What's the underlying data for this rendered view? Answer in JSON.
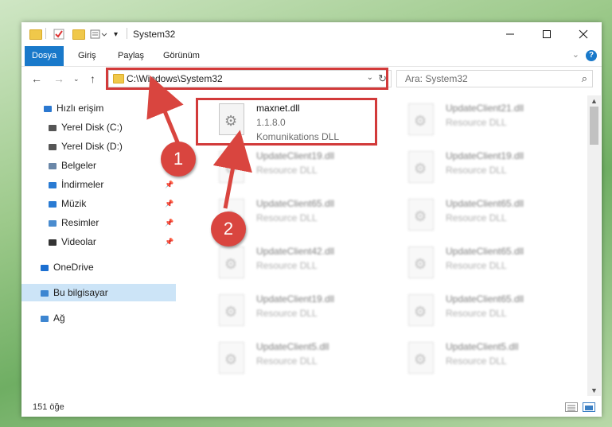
{
  "window": {
    "title": "System32"
  },
  "ribbon": {
    "tabs": [
      "Dosya",
      "Giriş",
      "Paylaş",
      "Görünüm"
    ]
  },
  "address": {
    "path": "C:\\Windows\\System32"
  },
  "search": {
    "placeholder": "Ara: System32"
  },
  "sidebar": {
    "items": [
      {
        "label": "Hızlı erişim",
        "icon": "star-icon"
      },
      {
        "label": "Yerel Disk (C:)",
        "icon": "drive-icon"
      },
      {
        "label": "Yerel Disk (D:)",
        "icon": "drive-icon"
      },
      {
        "label": "Belgeler",
        "icon": "documents-icon"
      },
      {
        "label": "İndirmeler",
        "icon": "download-icon"
      },
      {
        "label": "Müzik",
        "icon": "music-icon"
      },
      {
        "label": "Resimler",
        "icon": "pictures-icon"
      },
      {
        "label": "Videolar",
        "icon": "video-icon"
      },
      {
        "label": "OneDrive",
        "icon": "cloud-icon"
      },
      {
        "label": "Bu bilgisayar",
        "icon": "computer-icon"
      },
      {
        "label": "Ağ",
        "icon": "network-icon"
      }
    ]
  },
  "files": [
    {
      "name": "maxnet.dll",
      "version": "1.1.8.0",
      "desc": "Komunikations DLL"
    },
    {
      "name": "UpdateClient21.dll",
      "desc": "Resource DLL"
    },
    {
      "name": "UpdateClient19.dll",
      "desc": "Resource DLL"
    },
    {
      "name": "UpdateClient19.dll",
      "desc": "Resource DLL"
    },
    {
      "name": "UpdateClient65.dll",
      "desc": "Resource DLL"
    },
    {
      "name": "UpdateClient65.dll",
      "desc": "Resource DLL"
    },
    {
      "name": "UpdateClient42.dll",
      "desc": "Resource DLL"
    },
    {
      "name": "UpdateClient65.dll",
      "desc": "Resource DLL"
    },
    {
      "name": "UpdateClient19.dll",
      "desc": "Resource DLL"
    },
    {
      "name": "UpdateClient65.dll",
      "desc": "Resource DLL"
    },
    {
      "name": "UpdateClient5.dll",
      "desc": "Resource DLL"
    },
    {
      "name": "UpdateClient5.dll",
      "desc": "Resource DLL"
    }
  ],
  "status": {
    "count": "151 öğe"
  },
  "callouts": [
    "1",
    "2"
  ],
  "colors": {
    "accent": "#1979ca",
    "highlight": "#d23a3a",
    "callout": "#d9453f"
  }
}
